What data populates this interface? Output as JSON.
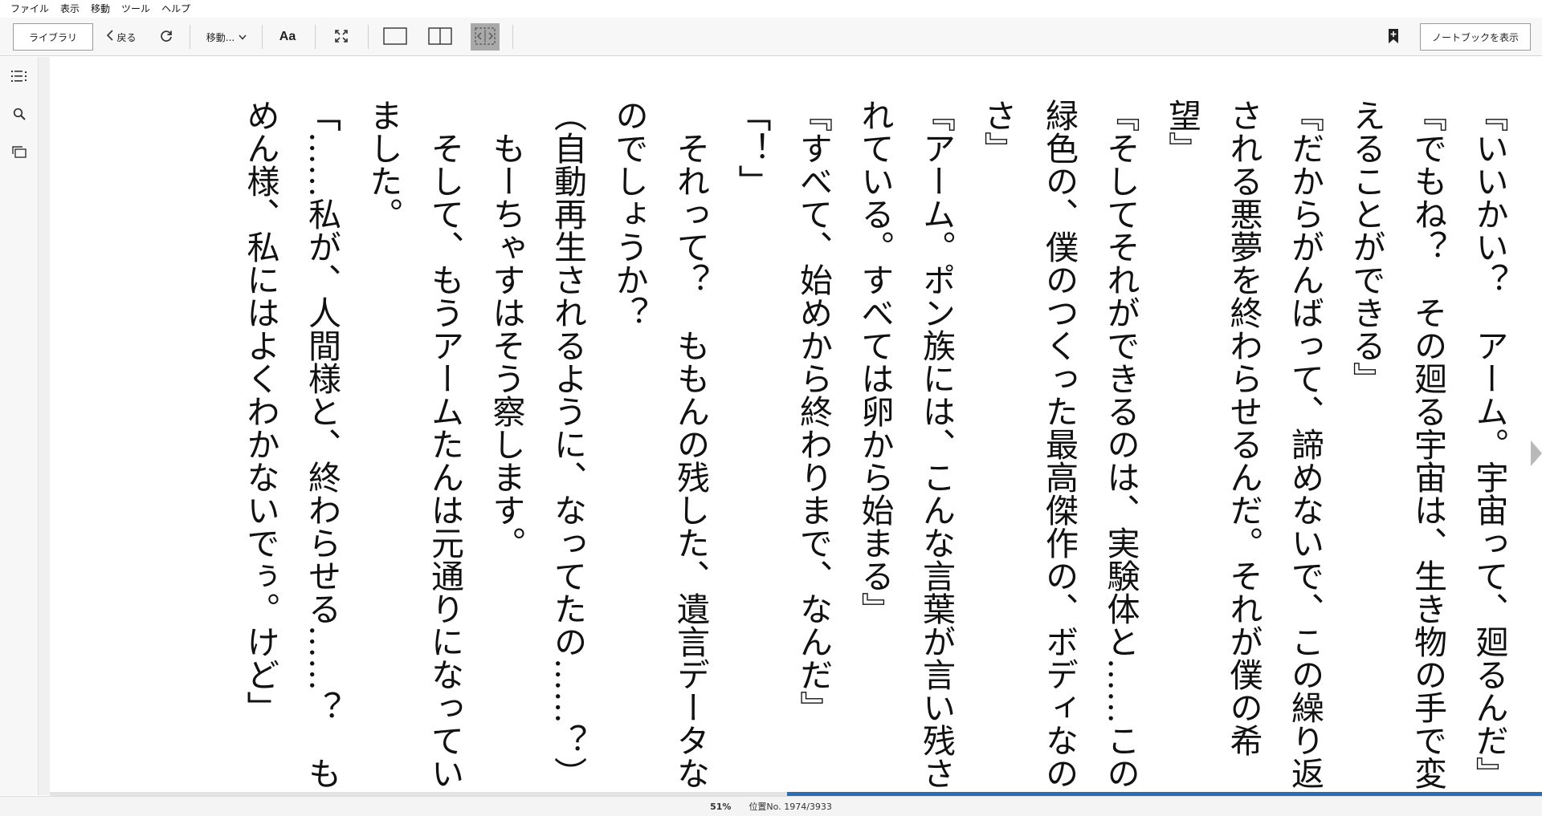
{
  "menu": [
    "ファイル",
    "表示",
    "移動",
    "ツール",
    "ヘルプ"
  ],
  "toolbar": {
    "library_label": "ライブラリ",
    "back_label": "戻る",
    "goto_label": "移動...",
    "font_label": "Aa",
    "notebook_label": "ノートブックを表示"
  },
  "icons": {
    "back": "chevron-left-icon",
    "refresh": "refresh-icon",
    "goto_caret": "chevron-down-icon",
    "fullscreen": "fullscreen-icon",
    "single_page": "single-page-icon",
    "two_page": "two-page-icon",
    "fit_view": "fit-view-icon",
    "bookmark": "bookmark-add-icon",
    "toc": "toc-icon",
    "search": "search-icon",
    "flashcards": "flashcards-icon",
    "next_page": "next-page-icon"
  },
  "colors": {
    "progress": "#2d6db4",
    "active_view": "#a9a9a9"
  },
  "content": {
    "lines": [
      "『いいかい？　アーム。宇宙って、廻るんだ』",
      "『でもね？　その廻る宇宙は、生き物の手で変",
      "えることができる』",
      "『だからがんばって、諦めないで、この繰り返",
      "される悪夢を終わらせるんだ。それが僕の希",
      "望』",
      "『そしてそれができるのは、実験体と……この",
      "緑色の、僕のつくった最高傑作の、ボディなの",
      "さ』",
      "『アーム。ポン族には、こんな言葉が言い残さ",
      "れている。すべては卵から始まる』",
      "『すべて、始めから終わりまで、なんだ』",
      "",
      "「！」",
      "　それって？　ももんの残した、遺言データな",
      "のでしょうか？",
      "（自動再生されるように、なってたの……？）",
      "　もーちゃすはそう察します。",
      "　そして、もうアームたんは元通りになってい",
      "ました。",
      "「……私が、人間様と、終わらせる……？　も",
      "めん様、私にはよくわかないでぅ。けど」"
    ]
  },
  "status": {
    "progress_percent": "51%",
    "position_label": "位置No. 1974/3933",
    "progress_fraction": 0.51
  }
}
